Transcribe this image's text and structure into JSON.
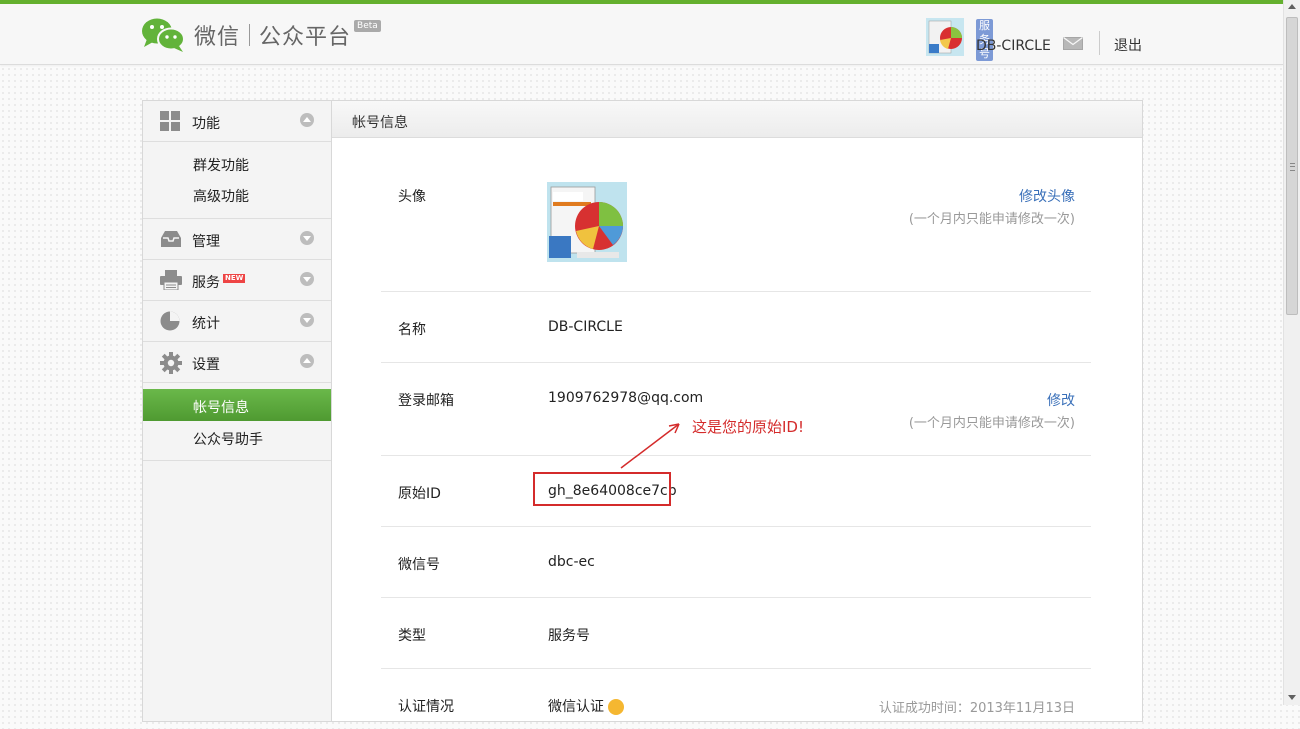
{
  "header": {
    "brand": "微信",
    "platform": "公众平台",
    "beta": "Beta",
    "account_type_badge": "服务号",
    "account_name": "DB-CIRCLE",
    "logout": "退出"
  },
  "sidebar": {
    "sections": [
      {
        "label": "功能",
        "icon": "grid-icon",
        "expanded": true,
        "items": [
          "群发功能",
          "高级功能"
        ]
      },
      {
        "label": "管理",
        "icon": "inbox-icon",
        "expanded": false
      },
      {
        "label": "服务",
        "icon": "printer-icon",
        "expanded": false,
        "badge": "NEW"
      },
      {
        "label": "统计",
        "icon": "pie-chart-icon",
        "expanded": false
      },
      {
        "label": "设置",
        "icon": "gear-icon",
        "expanded": true,
        "items": [
          "帐号信息",
          "公众号助手"
        ],
        "active": "帐号信息"
      }
    ]
  },
  "main": {
    "title": "帐号信息",
    "rows": {
      "avatar": {
        "label": "头像",
        "link": "修改头像",
        "note": "(一个月内只能申请修改一次)"
      },
      "name": {
        "label": "名称",
        "value": "DB-CIRCLE"
      },
      "email": {
        "label": "登录邮箱",
        "value": "1909762978@qq.com",
        "link": "修改",
        "note": "(一个月内只能申请修改一次)"
      },
      "original_id": {
        "label": "原始ID",
        "value": "gh_8e64008ce7cb",
        "annotation": "这是您的原始ID!"
      },
      "wechat_id": {
        "label": "微信号",
        "value": "dbc-ec"
      },
      "type": {
        "label": "类型",
        "value": "服务号"
      },
      "verification": {
        "label": "认证情况",
        "value": "微信认证",
        "note": "认证成功时间：2013年11月13日"
      }
    }
  },
  "colors": {
    "brand_green": "#64b02e",
    "active_green": "#5aa63a",
    "link_blue": "#3a70b9",
    "annotation_red": "#d42b2b",
    "badge_blue": "#7d9ad6"
  }
}
